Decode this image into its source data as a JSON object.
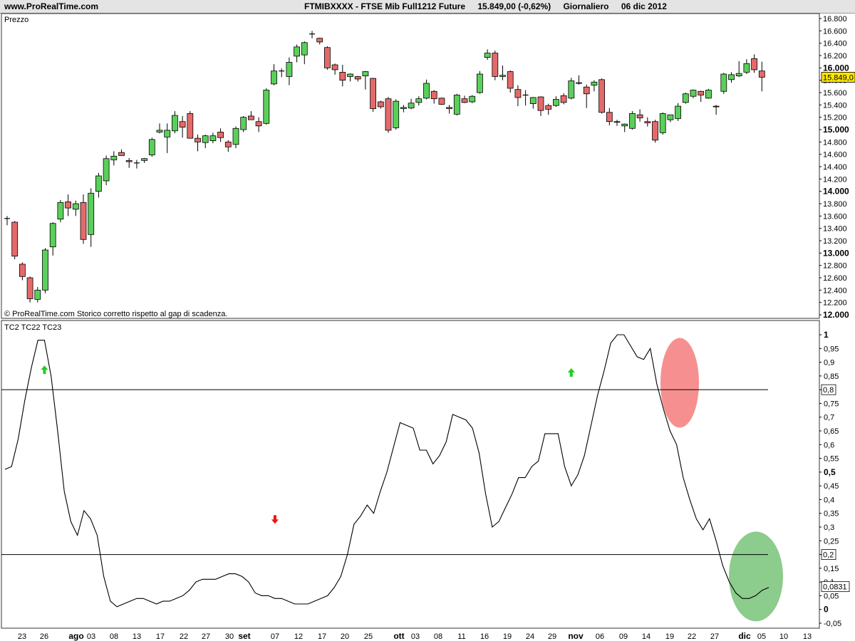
{
  "header": {
    "site": "www.ProRealTime.com",
    "instrument": "FTMIBXXXX - FTSE Mib Full1212 Future",
    "quote": "15.849,00 (-0,62%)",
    "period": "Giornaliero",
    "date": "06 dic 2012"
  },
  "colors": {
    "up_candle": "#5ad05a",
    "down_candle": "#e46a6a",
    "last_price_box": "#ffe600",
    "overbought_ellipse": "#f47c7c",
    "oversold_ellipse": "#6fbf6f",
    "arrow_up": "#22cc22",
    "arrow_down": "#ee1111"
  },
  "chart_data": [
    {
      "type": "candlestick",
      "panel_label": "Prezzo",
      "footnote": "© ProRealTime.com  Storico corretto rispetto al gap di scadenza.",
      "y_ticks": [
        "16.800",
        "16.600",
        "16.400",
        "16.200",
        "16.000",
        "15.800",
        "15.600",
        "15.400",
        "15.200",
        "15.000",
        "14.800",
        "14.600",
        "14.400",
        "14.200",
        "14.000",
        "13.800",
        "13.600",
        "13.400",
        "13.200",
        "13.000",
        "12.800",
        "12.600",
        "12.400",
        "12.200",
        "12.000"
      ],
      "y_tick_values": [
        16800,
        16600,
        16400,
        16200,
        16000,
        15800,
        15600,
        15400,
        15200,
        15000,
        14800,
        14600,
        14400,
        14200,
        14000,
        13800,
        13600,
        13400,
        13200,
        13000,
        12800,
        12600,
        12400,
        12200,
        12000
      ],
      "ylim": [
        12000,
        16800
      ],
      "last_price": 15849,
      "last_price_label": "15.849,0",
      "x_labels": [
        {
          "label": "23",
          "bold": false
        },
        {
          "label": "26",
          "bold": false
        },
        {
          "label": "ago",
          "bold": true
        },
        {
          "label": "03",
          "bold": false
        },
        {
          "label": "08",
          "bold": false
        },
        {
          "label": "13",
          "bold": false
        },
        {
          "label": "17",
          "bold": false
        },
        {
          "label": "22",
          "bold": false
        },
        {
          "label": "27",
          "bold": false
        },
        {
          "label": "30",
          "bold": false
        },
        {
          "label": "set",
          "bold": true
        },
        {
          "label": "07",
          "bold": false
        },
        {
          "label": "12",
          "bold": false
        },
        {
          "label": "17",
          "bold": false
        },
        {
          "label": "20",
          "bold": false
        },
        {
          "label": "25",
          "bold": false
        },
        {
          "label": "ott",
          "bold": true
        },
        {
          "label": "03",
          "bold": false
        },
        {
          "label": "08",
          "bold": false
        },
        {
          "label": "11",
          "bold": false
        },
        {
          "label": "16",
          "bold": false
        },
        {
          "label": "19",
          "bold": false
        },
        {
          "label": "24",
          "bold": false
        },
        {
          "label": "29",
          "bold": false
        },
        {
          "label": "nov",
          "bold": true
        },
        {
          "label": "06",
          "bold": false
        },
        {
          "label": "09",
          "bold": false
        },
        {
          "label": "14",
          "bold": false
        },
        {
          "label": "19",
          "bold": false
        },
        {
          "label": "22",
          "bold": false
        },
        {
          "label": "27",
          "bold": false
        },
        {
          "label": "dic",
          "bold": true
        },
        {
          "label": "05",
          "bold": false
        },
        {
          "label": "10",
          "bold": false
        },
        {
          "label": "13",
          "bold": false
        }
      ],
      "candles": [
        {
          "o": 13560,
          "h": 13600,
          "l": 13450,
          "c": 13560
        },
        {
          "o": 13500,
          "h": 13520,
          "l": 12900,
          "c": 12950
        },
        {
          "o": 12820,
          "h": 12850,
          "l": 12560,
          "c": 12620
        },
        {
          "o": 12600,
          "h": 12620,
          "l": 12200,
          "c": 12260
        },
        {
          "o": 12250,
          "h": 12450,
          "l": 12200,
          "c": 12400
        },
        {
          "o": 12400,
          "h": 13080,
          "l": 12350,
          "c": 13050
        },
        {
          "o": 13100,
          "h": 13500,
          "l": 12960,
          "c": 13480
        },
        {
          "o": 13550,
          "h": 13860,
          "l": 13500,
          "c": 13820
        },
        {
          "o": 13830,
          "h": 13950,
          "l": 13600,
          "c": 13730
        },
        {
          "o": 13710,
          "h": 13850,
          "l": 13600,
          "c": 13800
        },
        {
          "o": 13820,
          "h": 13950,
          "l": 13150,
          "c": 13220
        },
        {
          "o": 13300,
          "h": 14050,
          "l": 13100,
          "c": 13970
        },
        {
          "o": 14000,
          "h": 14300,
          "l": 13900,
          "c": 14250
        },
        {
          "o": 14170,
          "h": 14580,
          "l": 14100,
          "c": 14530
        },
        {
          "o": 14510,
          "h": 14650,
          "l": 14420,
          "c": 14570
        },
        {
          "o": 14630,
          "h": 14680,
          "l": 14580,
          "c": 14580
        },
        {
          "o": 14500,
          "h": 14540,
          "l": 14380,
          "c": 14480
        },
        {
          "o": 14460,
          "h": 14510,
          "l": 14370,
          "c": 14460
        },
        {
          "o": 14500,
          "h": 14540,
          "l": 14460,
          "c": 14530
        },
        {
          "o": 14590,
          "h": 14870,
          "l": 14560,
          "c": 14840
        },
        {
          "o": 14960,
          "h": 15100,
          "l": 14940,
          "c": 14990
        },
        {
          "o": 14880,
          "h": 15100,
          "l": 14620,
          "c": 14990
        },
        {
          "o": 14980,
          "h": 15300,
          "l": 14940,
          "c": 15230
        },
        {
          "o": 15130,
          "h": 15220,
          "l": 14870,
          "c": 15040
        },
        {
          "o": 15260,
          "h": 15300,
          "l": 14960,
          "c": 14860
        },
        {
          "o": 14860,
          "h": 14920,
          "l": 14650,
          "c": 14800
        },
        {
          "o": 14790,
          "h": 14920,
          "l": 14700,
          "c": 14900
        },
        {
          "o": 14820,
          "h": 14950,
          "l": 14780,
          "c": 14900
        },
        {
          "o": 14960,
          "h": 15020,
          "l": 14800,
          "c": 14870
        },
        {
          "o": 14800,
          "h": 14830,
          "l": 14640,
          "c": 14720
        },
        {
          "o": 14760,
          "h": 15050,
          "l": 14700,
          "c": 15020
        },
        {
          "o": 15000,
          "h": 15220,
          "l": 14960,
          "c": 15200
        },
        {
          "o": 15220,
          "h": 15300,
          "l": 15160,
          "c": 15160
        },
        {
          "o": 15130,
          "h": 15200,
          "l": 14960,
          "c": 15060
        },
        {
          "o": 15100,
          "h": 15670,
          "l": 15080,
          "c": 15640
        },
        {
          "o": 15740,
          "h": 16060,
          "l": 15720,
          "c": 15950
        },
        {
          "o": 15950,
          "h": 15990,
          "l": 15850,
          "c": 15950
        },
        {
          "o": 15860,
          "h": 16170,
          "l": 15720,
          "c": 16090
        },
        {
          "o": 16190,
          "h": 16380,
          "l": 16090,
          "c": 16340
        },
        {
          "o": 16210,
          "h": 16430,
          "l": 16060,
          "c": 16410
        },
        {
          "o": 16550,
          "h": 16600,
          "l": 16480,
          "c": 16550
        },
        {
          "o": 16480,
          "h": 16490,
          "l": 16380,
          "c": 16420
        },
        {
          "o": 16330,
          "h": 16350,
          "l": 15970,
          "c": 16000
        },
        {
          "o": 16050,
          "h": 16070,
          "l": 15890,
          "c": 15970
        },
        {
          "o": 15930,
          "h": 16050,
          "l": 15700,
          "c": 15800
        },
        {
          "o": 15860,
          "h": 15910,
          "l": 15780,
          "c": 15900
        },
        {
          "o": 15860,
          "h": 15870,
          "l": 15780,
          "c": 15820
        },
        {
          "o": 15870,
          "h": 15950,
          "l": 15650,
          "c": 15940
        },
        {
          "o": 15830,
          "h": 15840,
          "l": 15290,
          "c": 15340
        },
        {
          "o": 15450,
          "h": 15470,
          "l": 15340,
          "c": 15370
        },
        {
          "o": 15500,
          "h": 15530,
          "l": 14950,
          "c": 14990
        },
        {
          "o": 15030,
          "h": 15490,
          "l": 15000,
          "c": 15460
        },
        {
          "o": 15340,
          "h": 15400,
          "l": 15280,
          "c": 15360
        },
        {
          "o": 15350,
          "h": 15500,
          "l": 15330,
          "c": 15430
        },
        {
          "o": 15440,
          "h": 15540,
          "l": 15390,
          "c": 15500
        },
        {
          "o": 15510,
          "h": 15810,
          "l": 15490,
          "c": 15750
        },
        {
          "o": 15620,
          "h": 15640,
          "l": 15420,
          "c": 15500
        },
        {
          "o": 15510,
          "h": 15520,
          "l": 15400,
          "c": 15410
        },
        {
          "o": 15360,
          "h": 15400,
          "l": 15260,
          "c": 15340
        },
        {
          "o": 15250,
          "h": 15580,
          "l": 15230,
          "c": 15560
        },
        {
          "o": 15500,
          "h": 15550,
          "l": 15430,
          "c": 15440
        },
        {
          "o": 15450,
          "h": 15560,
          "l": 15430,
          "c": 15540
        },
        {
          "o": 15600,
          "h": 15950,
          "l": 15580,
          "c": 15900
        },
        {
          "o": 16170,
          "h": 16300,
          "l": 16130,
          "c": 16240
        },
        {
          "o": 16240,
          "h": 16280,
          "l": 15800,
          "c": 15860
        },
        {
          "o": 15860,
          "h": 16040,
          "l": 15800,
          "c": 15880
        },
        {
          "o": 15940,
          "h": 15960,
          "l": 15600,
          "c": 15670
        },
        {
          "o": 15650,
          "h": 15720,
          "l": 15380,
          "c": 15520
        },
        {
          "o": 15560,
          "h": 15640,
          "l": 15390,
          "c": 15560
        },
        {
          "o": 15420,
          "h": 15530,
          "l": 15340,
          "c": 15520
        },
        {
          "o": 15530,
          "h": 15540,
          "l": 15220,
          "c": 15310
        },
        {
          "o": 15390,
          "h": 15420,
          "l": 15240,
          "c": 15330
        },
        {
          "o": 15390,
          "h": 15540,
          "l": 15370,
          "c": 15490
        },
        {
          "o": 15550,
          "h": 15590,
          "l": 15410,
          "c": 15440
        },
        {
          "o": 15510,
          "h": 15840,
          "l": 15490,
          "c": 15790
        },
        {
          "o": 15750,
          "h": 15880,
          "l": 15730,
          "c": 15760
        },
        {
          "o": 15690,
          "h": 15730,
          "l": 15350,
          "c": 15580
        },
        {
          "o": 15720,
          "h": 15800,
          "l": 15620,
          "c": 15770
        },
        {
          "o": 15810,
          "h": 15830,
          "l": 15260,
          "c": 15280
        },
        {
          "o": 15280,
          "h": 15350,
          "l": 15070,
          "c": 15130
        },
        {
          "o": 15130,
          "h": 15160,
          "l": 15060,
          "c": 15120
        },
        {
          "o": 15060,
          "h": 15100,
          "l": 14960,
          "c": 15090
        },
        {
          "o": 15020,
          "h": 15300,
          "l": 15000,
          "c": 15260
        },
        {
          "o": 15240,
          "h": 15330,
          "l": 15130,
          "c": 15190
        },
        {
          "o": 15130,
          "h": 15200,
          "l": 15050,
          "c": 15110
        },
        {
          "o": 15130,
          "h": 15160,
          "l": 14790,
          "c": 14830
        },
        {
          "o": 14950,
          "h": 15280,
          "l": 14920,
          "c": 15260
        },
        {
          "o": 15160,
          "h": 15240,
          "l": 15120,
          "c": 15240
        },
        {
          "o": 15180,
          "h": 15430,
          "l": 15140,
          "c": 15380
        },
        {
          "o": 15440,
          "h": 15600,
          "l": 15420,
          "c": 15580
        },
        {
          "o": 15540,
          "h": 15650,
          "l": 15510,
          "c": 15640
        },
        {
          "o": 15620,
          "h": 15630,
          "l": 15450,
          "c": 15560
        },
        {
          "o": 15510,
          "h": 15660,
          "l": 15500,
          "c": 15640
        },
        {
          "o": 15380,
          "h": 15400,
          "l": 15240,
          "c": 15370
        },
        {
          "o": 15620,
          "h": 15920,
          "l": 15580,
          "c": 15900
        },
        {
          "o": 15810,
          "h": 15930,
          "l": 15760,
          "c": 15890
        },
        {
          "o": 15870,
          "h": 16110,
          "l": 15850,
          "c": 15910
        },
        {
          "o": 15930,
          "h": 16140,
          "l": 15900,
          "c": 16070
        },
        {
          "o": 16150,
          "h": 16220,
          "l": 15920,
          "c": 15970
        },
        {
          "o": 15950,
          "h": 16100,
          "l": 15620,
          "c": 15849
        }
      ]
    },
    {
      "type": "line",
      "panel_label": "TC2 TC22 TC23",
      "y_ticks": [
        "1",
        "0,95",
        "0,9",
        "0,85",
        "0,8",
        "0,75",
        "0,7",
        "0,65",
        "0,6",
        "0,55",
        "0,5",
        "0,45",
        "0,4",
        "0,35",
        "0,3",
        "0,25",
        "0,2",
        "0,15",
        "0,1",
        "0,05",
        "0",
        "-0,05"
      ],
      "y_tick_values": [
        1,
        0.95,
        0.9,
        0.85,
        0.8,
        0.75,
        0.7,
        0.65,
        0.6,
        0.55,
        0.5,
        0.45,
        0.4,
        0.35,
        0.3,
        0.25,
        0.2,
        0.15,
        0.1,
        0.05,
        0,
        -0.05
      ],
      "bold_ticks": [
        "1",
        "0,5",
        "0"
      ],
      "ylim": [
        -0.05,
        1.0
      ],
      "reference_lines": [
        {
          "value": 0.8,
          "label": "0,8"
        },
        {
          "value": 0.2,
          "label": "0,2"
        }
      ],
      "last_value": 0.0831,
      "last_value_label": "0,0831",
      "series": [
        {
          "values": [
            0.51,
            0.52,
            0.62,
            0.76,
            0.88,
            0.98,
            0.98,
            0.85,
            0.65,
            0.43,
            0.32,
            0.27,
            0.36,
            0.33,
            0.27,
            0.12,
            0.03,
            0.01,
            0.02,
            0.03,
            0.04,
            0.04,
            0.03,
            0.02,
            0.03,
            0.03,
            0.04,
            0.05,
            0.07,
            0.1,
            0.11,
            0.11,
            0.11,
            0.12,
            0.13,
            0.13,
            0.12,
            0.1,
            0.06,
            0.05,
            0.05,
            0.04,
            0.04,
            0.03,
            0.02,
            0.02,
            0.02,
            0.03,
            0.04,
            0.05,
            0.08,
            0.12,
            0.2,
            0.31,
            0.34,
            0.38,
            0.35,
            0.43,
            0.5,
            0.59,
            0.68,
            0.67,
            0.66,
            0.58,
            0.58,
            0.53,
            0.56,
            0.61,
            0.71,
            0.7,
            0.69,
            0.66,
            0.57,
            0.42,
            0.3,
            0.32,
            0.37,
            0.42,
            0.48,
            0.48,
            0.52,
            0.54,
            0.64,
            0.64,
            0.64,
            0.52,
            0.45,
            0.49,
            0.56,
            0.67,
            0.78,
            0.87,
            0.97,
            1.0,
            1.0,
            0.96,
            0.92,
            0.91,
            0.95,
            0.82,
            0.73,
            0.65,
            0.6,
            0.48,
            0.4,
            0.33,
            0.29,
            0.33,
            0.25,
            0.16,
            0.1,
            0.06,
            0.04,
            0.04,
            0.05,
            0.07,
            0.08
          ]
        }
      ],
      "markers": [
        {
          "type": "arrow-up",
          "index": 6,
          "value": 0.87
        },
        {
          "type": "arrow-down",
          "index": 41,
          "value": 0.33
        },
        {
          "type": "arrow-up",
          "index": 86,
          "value": 0.86
        }
      ]
    }
  ]
}
